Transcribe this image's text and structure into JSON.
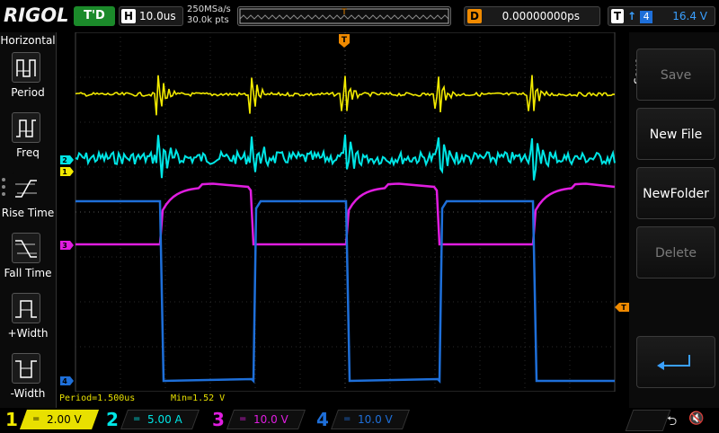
{
  "top": {
    "logo": "RIGOL",
    "run_state": "T'D",
    "timebase_key": "H",
    "timebase": "10.0us",
    "sample_rate": "250MSa/s",
    "memory_depth": "30.0k pts",
    "delay_key": "D",
    "delay": "0.00000000ps",
    "trigger_key": "T",
    "trigger_edge": "↑",
    "trigger_source": "4",
    "trigger_level": "16.4 V"
  },
  "left_menu": {
    "title": "Horizontal",
    "items": [
      {
        "label": "Period",
        "icon": "period-icon"
      },
      {
        "label": "Freq",
        "icon": "frequency-icon"
      },
      {
        "label": "Rise Time",
        "icon": "rise-time-icon"
      },
      {
        "label": "Fall Time",
        "icon": "fall-time-icon"
      },
      {
        "label": "+Width",
        "icon": "positive-width-icon"
      },
      {
        "label": "-Width",
        "icon": "negative-width-icon"
      }
    ]
  },
  "right_menu": {
    "tab": "Save",
    "buttons": [
      {
        "label": "Save",
        "enabled": false
      },
      {
        "label": "New File",
        "enabled": true
      },
      {
        "label": "NewFolder",
        "enabled": true
      },
      {
        "label": "Delete",
        "enabled": false
      }
    ],
    "back_icon": "return-arrow-icon"
  },
  "markers": {
    "trigger_pos": "T",
    "trigger_level": "T",
    "ch1": "1",
    "ch2": "2",
    "ch3": "3",
    "ch4": "4"
  },
  "measurements": {
    "period": "Period=1.500us",
    "min": "Min=1.52 V"
  },
  "channels": [
    {
      "num": "1",
      "coupling": "=",
      "scale": "2.00 V",
      "color": "#f2ea00"
    },
    {
      "num": "2",
      "coupling": "=",
      "scale": "5.00 A",
      "color": "#00e5e5"
    },
    {
      "num": "3",
      "coupling": "=",
      "scale": "10.0 V",
      "color": "#e01de0"
    },
    {
      "num": "4",
      "coupling": "=",
      "scale": "10.0 V",
      "color": "#1e6fd9"
    }
  ],
  "colors": {
    "ch1": "#f2ea00",
    "ch2": "#00e5e5",
    "ch3": "#e01de0",
    "ch4": "#1e6fd9",
    "trigger": "#f08a00",
    "grid": "#2a2a2a"
  },
  "status_icons": [
    "usb-icon",
    "speaker-muted-icon"
  ]
}
